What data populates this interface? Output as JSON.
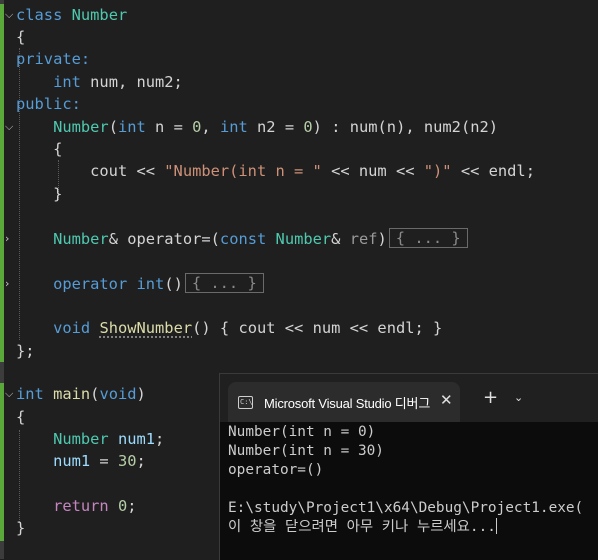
{
  "code": {
    "l1": {
      "kw": "class",
      "name": "Number"
    },
    "l2": "{",
    "l3": "private:",
    "l4": {
      "type": "int",
      "rest": " num, num2;"
    },
    "l5": "public:",
    "l6": {
      "ctor": "Number",
      "p1": "(",
      "int1": "int",
      "mid1": " n = ",
      "zero1": "0",
      "comma": ", ",
      "int2": "int",
      "mid2": " n2 = ",
      "zero2": "0",
      "rest1": ") : num(",
      "n": "n",
      "rest2": "), num2(",
      "n2": "n2",
      "rest3": ")"
    },
    "l7": "{",
    "l8": {
      "cout": "cout << ",
      "str1": "\"Number(int n = \"",
      "mid": " << num << ",
      "str2": "\")\"",
      "end": " << endl;"
    },
    "l9": "}",
    "l11": {
      "type": "Number",
      "amp": "& ",
      "fn": "operator=",
      "open": "(",
      "const": "const",
      "sp": " ",
      "type2": "Number",
      "amp2": "& ",
      "param": "ref",
      "close": ")",
      "collapsed": "{ ... }"
    },
    "l13": {
      "kw": "operator",
      "sp": " ",
      "type": "int",
      "paren": "()",
      "collapsed": "{ ... }"
    },
    "l15": {
      "kw": "void",
      "sp": " ",
      "fn": "ShowNumber",
      "rest": "() { cout << num << endl; }"
    },
    "l16": "};",
    "l18": {
      "type": "int",
      "sp": " ",
      "fn": "main",
      "open": "(",
      "void": "void",
      "close": ")"
    },
    "l19": "{",
    "l20": {
      "type": "Number",
      "sp": " ",
      "var": "num1",
      "end": ";"
    },
    "l21": {
      "var": "num1",
      "mid": " = ",
      "num": "30",
      "end": ";"
    },
    "l23": {
      "kw": "return",
      "sp": " ",
      "num": "0",
      "end": ";"
    },
    "l24": "}"
  },
  "terminal": {
    "tab_title": "Microsoft Visual Studio 디버그",
    "close_glyph": "✕",
    "new_tab_glyph": "+",
    "dropdown_glyph": "⌄",
    "icon_text": "C:\\",
    "lines": [
      "Number(int n = 0)",
      "Number(int n = 30)",
      "operator=()",
      "",
      "E:\\study\\Project1\\x64\\Debug\\Project1.exe(",
      "이 창을 닫으려면 아무 키나 누르세요..."
    ]
  },
  "colors": {
    "editor_bg": "#1f1f1f",
    "keyword": "#569cd6",
    "type": "#4ec9b0",
    "function": "#dcdcaa",
    "number": "#b5cea8",
    "string": "#ce9178",
    "parameter": "#9cdcfe",
    "change_bar": "#5aa83a",
    "terminal_bg": "#0c0c0c"
  }
}
